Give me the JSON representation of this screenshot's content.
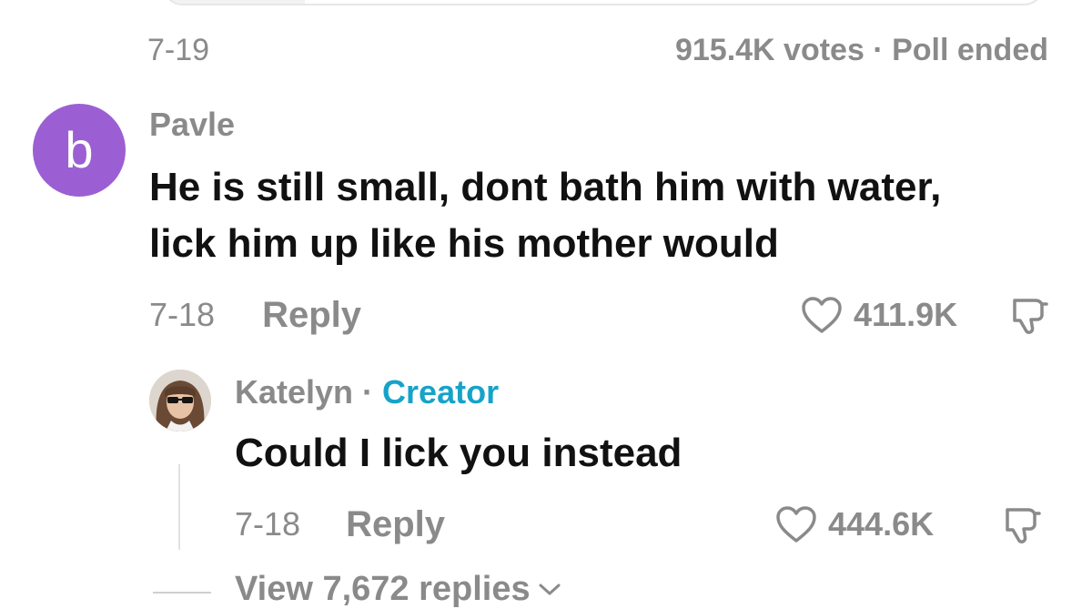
{
  "poll": {
    "date": "7-19",
    "status": "915.4K votes · Poll ended"
  },
  "comment": {
    "avatar_letter": "b",
    "author": "Pavle",
    "text_line1": "He is still small, dont bath him with water,",
    "text_line2": "lick him up like his mother would",
    "date": "7-18",
    "reply_label": "Reply",
    "likes": "411.9K"
  },
  "reply": {
    "author": "Katelyn",
    "separator": "·",
    "badge": "Creator",
    "text": "Could I lick you instead",
    "date": "7-18",
    "reply_label": "Reply",
    "likes": "444.6K"
  },
  "view_replies": {
    "label": "View 7,672 replies"
  },
  "colors": {
    "muted": "#8a8a8a",
    "avatar_bg": "#9b5fd3",
    "creator_badge": "#16a3c9"
  },
  "icons": [
    "heart-icon",
    "dislike-icon",
    "chevron-down-icon"
  ]
}
